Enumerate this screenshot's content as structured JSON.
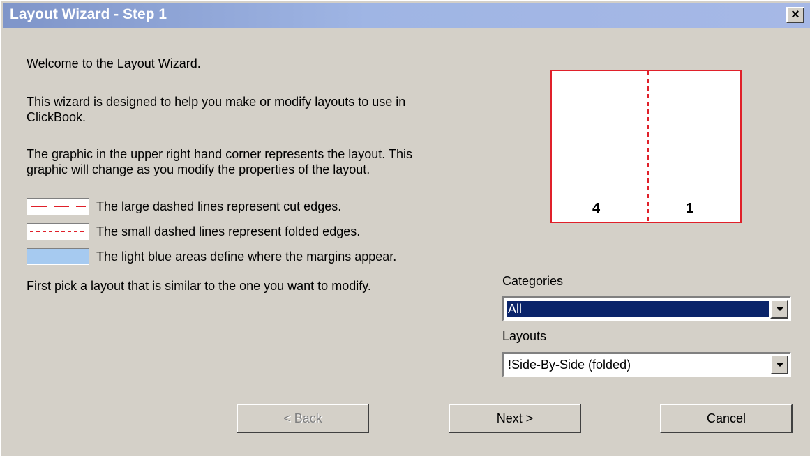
{
  "window": {
    "title": "Layout Wizard - Step 1",
    "close_label": "×"
  },
  "intro": {
    "welcome": "Welcome to the Layout Wizard.",
    "para1_line1": "This wizard is designed to help you make or modify layouts to use in",
    "para1_line2": "ClickBook.",
    "para2_line1": "The graphic in the upper right hand corner represents the layout.  This",
    "para2_line2": "graphic will change as you modify the properties of the layout."
  },
  "legend": {
    "cut": "The large dashed lines represent cut edges.",
    "fold": "The small dashed lines represent folded edges.",
    "margin": "The light blue areas define where the margins appear."
  },
  "instruction": "First pick a layout that is similar to the one you want to modify.",
  "preview": {
    "left_page": "4",
    "right_page": "1"
  },
  "categories": {
    "label": "Categories",
    "value": "All"
  },
  "layouts": {
    "label": "Layouts",
    "value": "!Side-By-Side (folded)"
  },
  "buttons": {
    "back": "< Back",
    "next": "Next >",
    "cancel": "Cancel"
  },
  "colors": {
    "line_red": "#e0202a",
    "margin_blue": "#a6caf0",
    "selection": "#0a246a"
  }
}
